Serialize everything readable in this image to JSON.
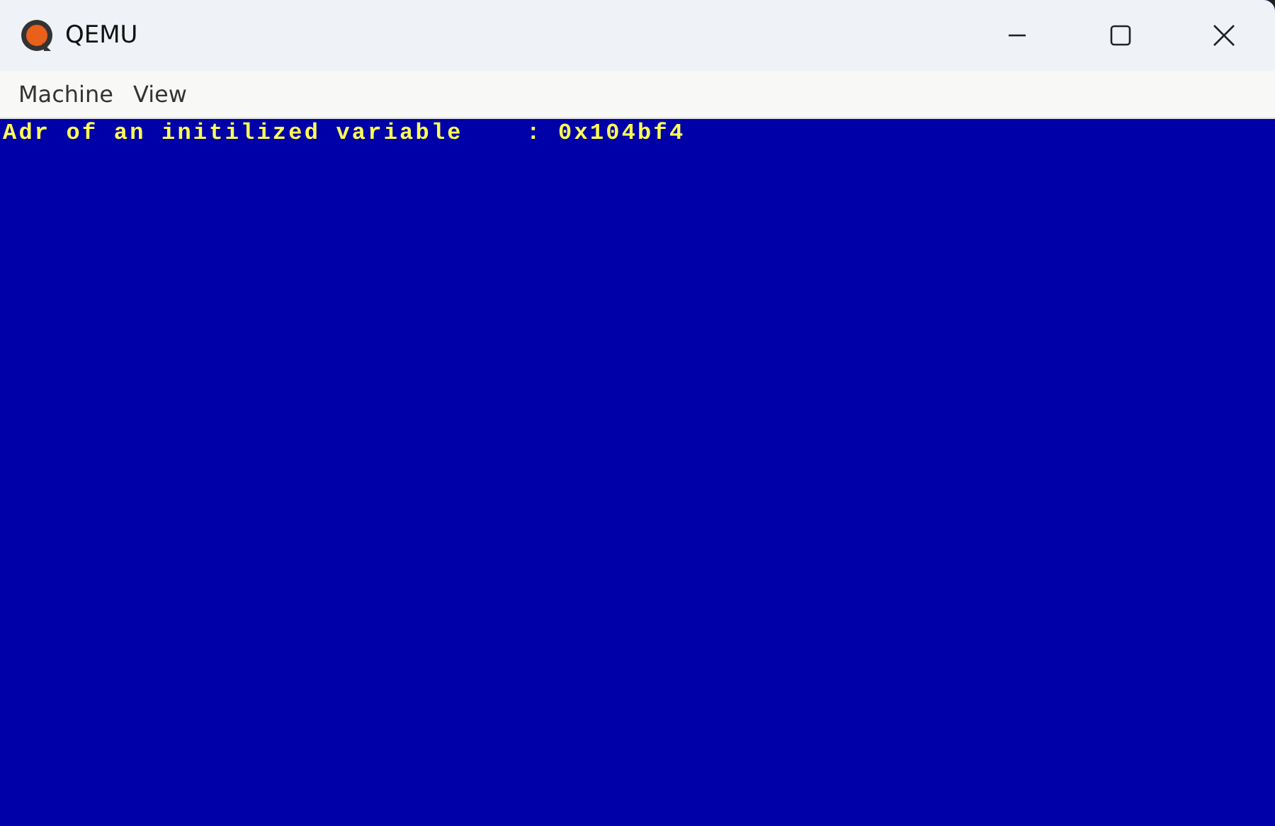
{
  "window": {
    "title": "QEMU"
  },
  "menu": [
    "Machine",
    "View"
  ],
  "console": {
    "lines": [
      "Adr of an initilized variable    : 0x104bf4"
    ]
  }
}
